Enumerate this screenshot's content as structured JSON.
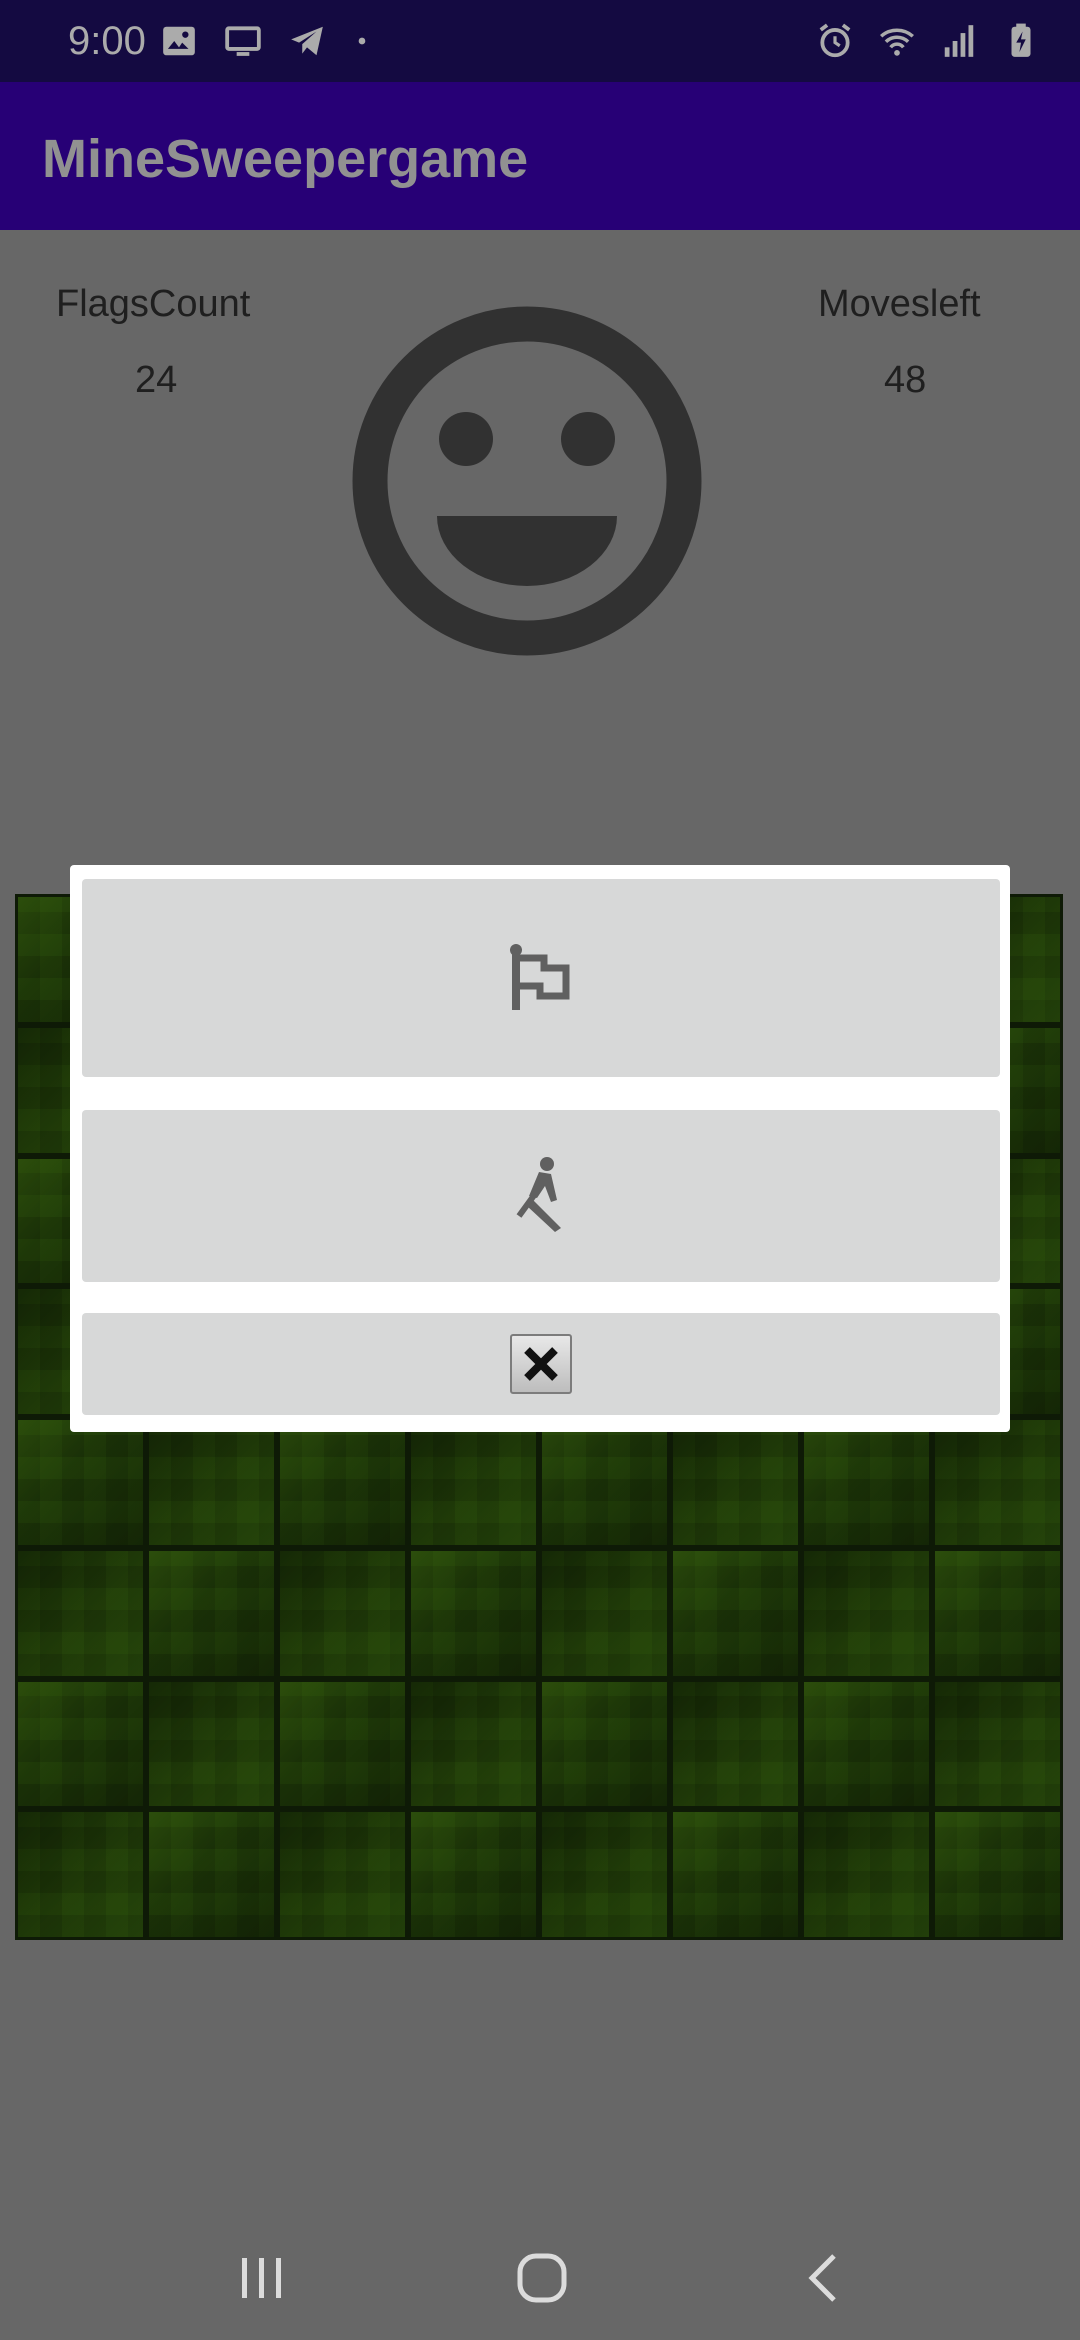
{
  "status_bar": {
    "time": "9:00",
    "left_icons": [
      "image-icon",
      "cast-icon",
      "telegram-icon",
      "dot-icon"
    ],
    "right_icons": [
      "alarm-icon",
      "wifi-icon",
      "signal-icon",
      "battery-charging-icon"
    ]
  },
  "app_bar": {
    "title": "MineSweepergame"
  },
  "stats": {
    "flags_label": "FlagsCount",
    "flags_value": "24",
    "moves_label": "Movesleft",
    "moves_value": "48"
  },
  "board": {
    "rows": 8,
    "columns": 8
  },
  "dialog": {
    "options": [
      {
        "name": "flag",
        "icon": "flag-icon"
      },
      {
        "name": "dig",
        "icon": "dig-icon"
      },
      {
        "name": "close",
        "icon": "close-icon"
      }
    ]
  },
  "nav_bar": {
    "icons": [
      "recent-apps-icon",
      "home-icon",
      "back-icon"
    ]
  },
  "colors": {
    "status_bar": "#1e0f62",
    "app_bar": "#3b00b1",
    "background": "#9a9a9a",
    "dialog_button": "#d7d8d8",
    "board_green": "#325a10"
  }
}
